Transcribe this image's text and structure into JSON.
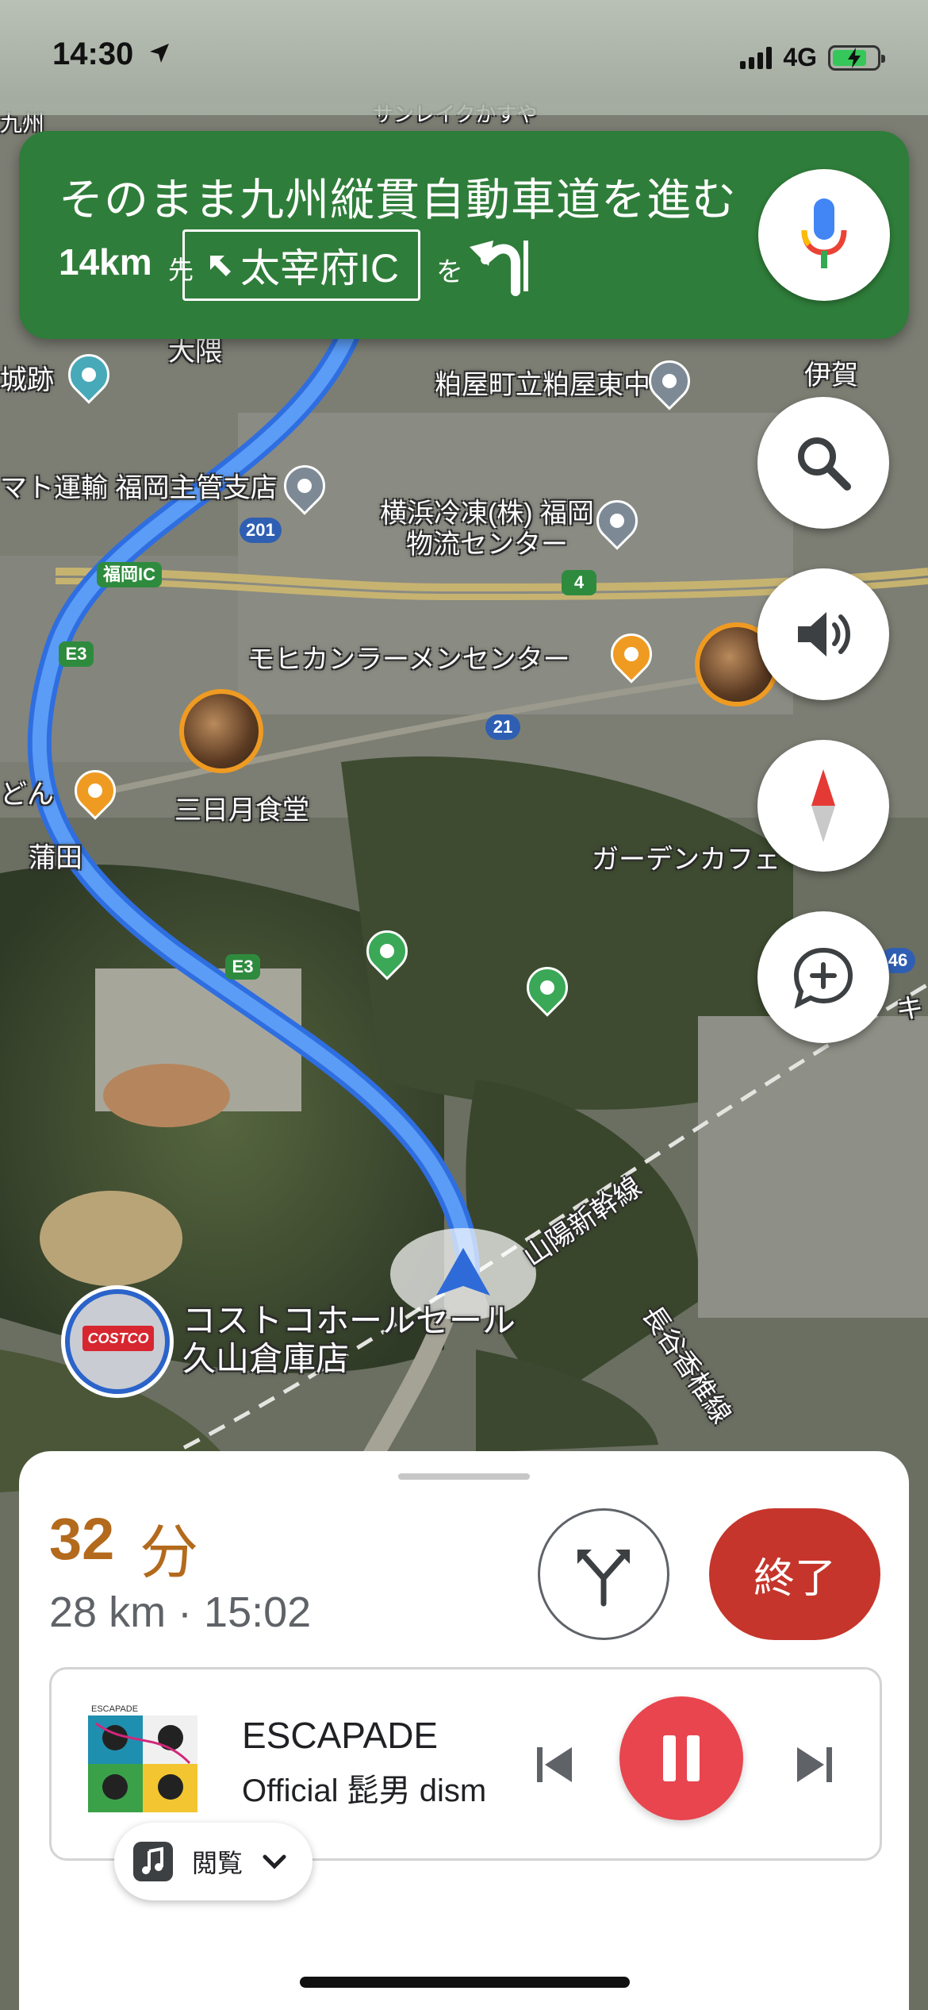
{
  "status_bar": {
    "time": "14:30",
    "network": "4G",
    "location_icon": "location-arrow-icon",
    "battery_icon": "battery-charging-icon"
  },
  "direction": {
    "instruction": "そのまま九州縦貫自動車道を進む",
    "distance": "14km",
    "distance_suffix": "先",
    "exit_name": "太宰府IC",
    "particle": "を",
    "turn_icon": "turn-sharp-left-icon",
    "banner_color": "#2f7d3a"
  },
  "map": {
    "labels": {
      "top_left": "九州",
      "top_right_fragment": "サンレイクかすや",
      "okuma": "大隈",
      "castle": "城跡",
      "kasuya_station": "粕屋町立粕屋東中",
      "iga": "伊賀",
      "yamato": "マト運輸 福岡主管支店",
      "yokohama": "横浜冷凍(株) 福岡物流センター",
      "fukuoka_ic": "福岡IC",
      "mohikan": "モヒカンラーメンセンター",
      "mikazuki": "三日月食堂",
      "udon": "どん",
      "kamata": "蒲田",
      "garden_cafe": "ガーデンカフェ",
      "sanyo_shinkansen": "山陽新幹線",
      "hasegawa": "長谷香椎線",
      "costco": "コストコホールセール 久山倉庫店",
      "right_edge": "キ"
    },
    "road_shields": {
      "r201": "201",
      "e3_top": "E3",
      "r4": "4",
      "r21": "21",
      "e3_bottom": "E3",
      "r46": "46"
    },
    "route_color": "#4d8ff5"
  },
  "fab": {
    "search_icon": "search-icon",
    "sound_icon": "volume-icon",
    "compass_icon": "compass-icon",
    "report_icon": "add-report-icon"
  },
  "trip": {
    "eta_minutes": "32",
    "eta_unit": "分",
    "info": "28 km · 15:02",
    "exit_label": "終了",
    "eta_color": "#b36a1d"
  },
  "music": {
    "album_band": "ESCAPADE",
    "title": "ESCAPADE",
    "artist": "Official 髭男 dism",
    "browse_label": "閲覧",
    "pause_color": "#e8454f"
  }
}
